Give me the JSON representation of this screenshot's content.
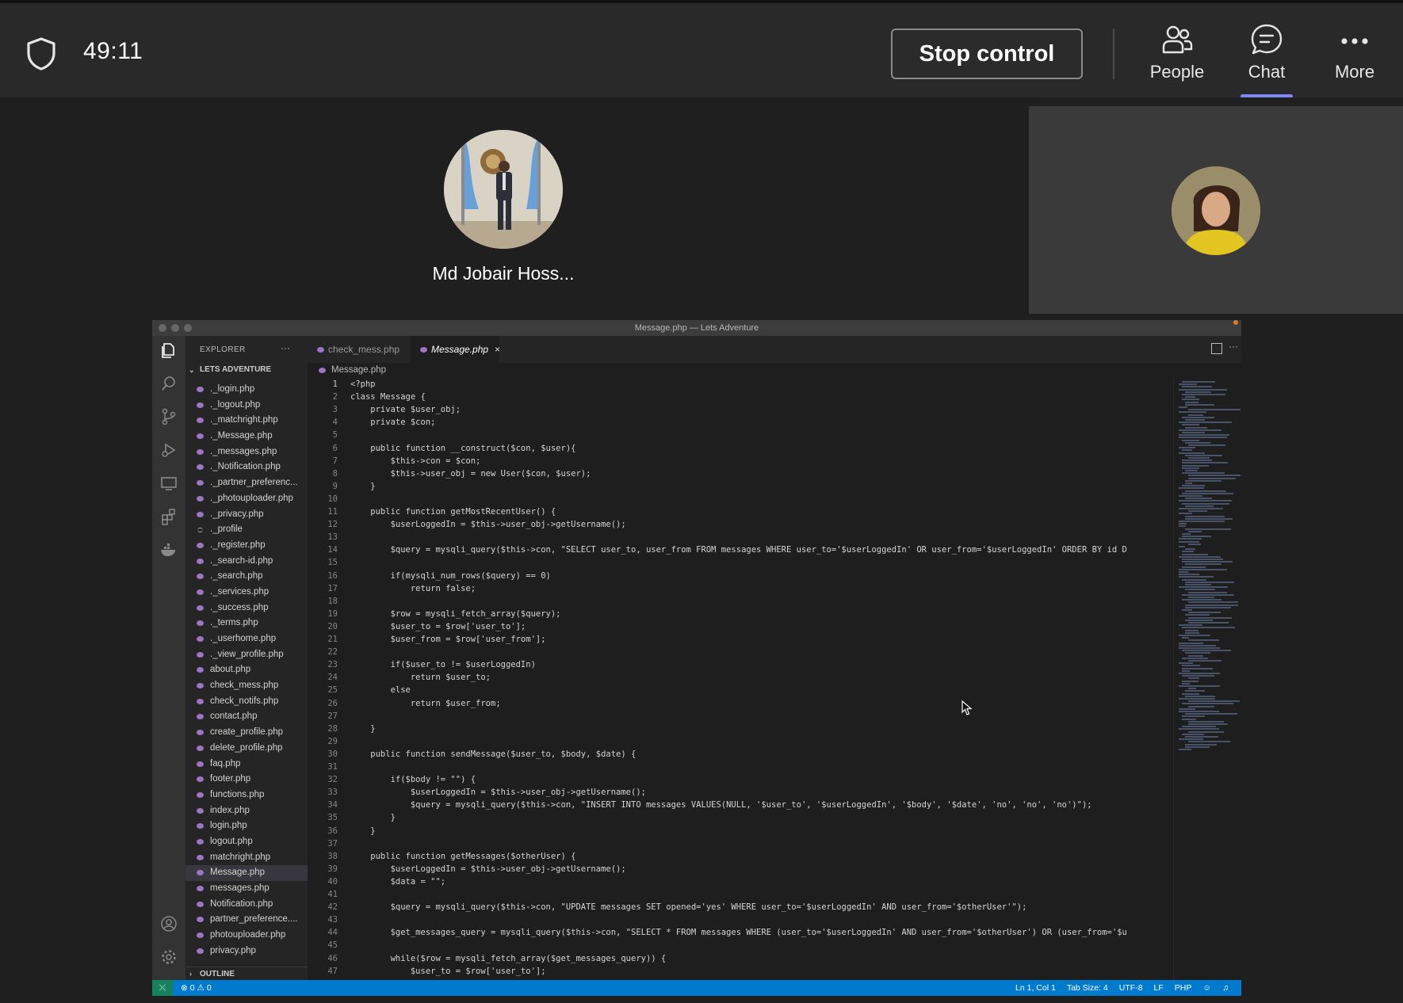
{
  "meeting": {
    "timer": "49:11",
    "stop_control_label": "Stop control",
    "people_label": "People",
    "chat_label": "Chat",
    "more_label": "More",
    "participant_name": "Md Jobair Hoss...",
    "accent_color": "#7f85f5"
  },
  "vscode": {
    "window_title": "Message.php — Lets Adventure",
    "explorer_title": "EXPLORER",
    "project_name": "LETS ADVENTURE",
    "outline_label": "OUTLINE",
    "tabs": [
      {
        "label": "check_mess.php",
        "active": false
      },
      {
        "label": "Message.php",
        "active": true
      }
    ],
    "breadcrumb": "Message.php",
    "files": [
      {
        "name": "._login.php",
        "icon": "php-icon"
      },
      {
        "name": "._logout.php",
        "icon": "php-icon"
      },
      {
        "name": "._matchright.php",
        "icon": "php-icon"
      },
      {
        "name": "._Message.php",
        "icon": "php-icon"
      },
      {
        "name": "._messages.php",
        "icon": "php-icon"
      },
      {
        "name": "._Notification.php",
        "icon": "php-icon"
      },
      {
        "name": "._partner_preferenc...",
        "icon": "php-icon"
      },
      {
        "name": "._photouploader.php",
        "icon": "php-icon"
      },
      {
        "name": "._privacy.php",
        "icon": "php-icon"
      },
      {
        "name": "._profile",
        "icon": "file-icon"
      },
      {
        "name": "._register.php",
        "icon": "php-icon"
      },
      {
        "name": "._search-id.php",
        "icon": "php-icon"
      },
      {
        "name": "._search.php",
        "icon": "php-icon"
      },
      {
        "name": "._services.php",
        "icon": "php-icon"
      },
      {
        "name": "._success.php",
        "icon": "php-icon"
      },
      {
        "name": "._terms.php",
        "icon": "php-icon"
      },
      {
        "name": "._userhome.php",
        "icon": "php-icon"
      },
      {
        "name": "._view_profile.php",
        "icon": "php-icon"
      },
      {
        "name": "about.php",
        "icon": "php-icon"
      },
      {
        "name": "check_mess.php",
        "icon": "php-icon"
      },
      {
        "name": "check_notifs.php",
        "icon": "php-icon"
      },
      {
        "name": "contact.php",
        "icon": "php-icon"
      },
      {
        "name": "create_profile.php",
        "icon": "php-icon"
      },
      {
        "name": "delete_profile.php",
        "icon": "php-icon"
      },
      {
        "name": "faq.php",
        "icon": "php-icon"
      },
      {
        "name": "footer.php",
        "icon": "php-icon"
      },
      {
        "name": "functions.php",
        "icon": "php-icon"
      },
      {
        "name": "index.php",
        "icon": "php-icon"
      },
      {
        "name": "login.php",
        "icon": "php-icon"
      },
      {
        "name": "logout.php",
        "icon": "php-icon"
      },
      {
        "name": "matchright.php",
        "icon": "php-icon"
      },
      {
        "name": "Message.php",
        "icon": "php-icon",
        "active": true
      },
      {
        "name": "messages.php",
        "icon": "php-icon"
      },
      {
        "name": "Notification.php",
        "icon": "php-icon"
      },
      {
        "name": "partner_preference....",
        "icon": "php-icon"
      },
      {
        "name": "photouploader.php",
        "icon": "php-icon"
      },
      {
        "name": "privacy.php",
        "icon": "php-icon"
      }
    ],
    "code_lines": [
      "<?php",
      "class Message {",
      "    private $user_obj;",
      "    private $con;",
      "",
      "    public function __construct($con, $user){",
      "        $this->con = $con;",
      "        $this->user_obj = new User($con, $user);",
      "    }",
      "",
      "    public function getMostRecentUser() {",
      "        $userLoggedIn = $this->user_obj->getUsername();",
      "",
      "        $query = mysqli_query($this->con, \"SELECT user_to, user_from FROM messages WHERE user_to='$userLoggedIn' OR user_from='$userLoggedIn' ORDER BY id D",
      "",
      "        if(mysqli_num_rows($query) == 0)",
      "            return false;",
      "",
      "        $row = mysqli_fetch_array($query);",
      "        $user_to = $row['user_to'];",
      "        $user_from = $row['user_from'];",
      "",
      "        if($user_to != $userLoggedIn)",
      "            return $user_to;",
      "        else",
      "            return $user_from;",
      "",
      "    }",
      "",
      "    public function sendMessage($user_to, $body, $date) {",
      "",
      "        if($body != \"\") {",
      "            $userLoggedIn = $this->user_obj->getUsername();",
      "            $query = mysqli_query($this->con, \"INSERT INTO messages VALUES(NULL, '$user_to', '$userLoggedIn', '$body', '$date', 'no', 'no', 'no')\");",
      "        }",
      "    }",
      "",
      "    public function getMessages($otherUser) {",
      "        $userLoggedIn = $this->user_obj->getUsername();",
      "        $data = \"\";",
      "",
      "        $query = mysqli_query($this->con, \"UPDATE messages SET opened='yes' WHERE user_to='$userLoggedIn' AND user_from='$otherUser'\");",
      "",
      "        $get_messages_query = mysqli_query($this->con, \"SELECT * FROM messages WHERE (user_to='$userLoggedIn' AND user_from='$otherUser') OR (user_from='$u",
      "",
      "        while($row = mysqli_fetch_array($get_messages_query)) {",
      "            $user_to = $row['user_to'];"
    ],
    "status": {
      "errors": "0",
      "warnings": "0",
      "position": "Ln 1, Col 1",
      "tab_size": "Tab Size: 4",
      "encoding": "UTF-8",
      "eol": "LF",
      "language": "PHP"
    }
  }
}
